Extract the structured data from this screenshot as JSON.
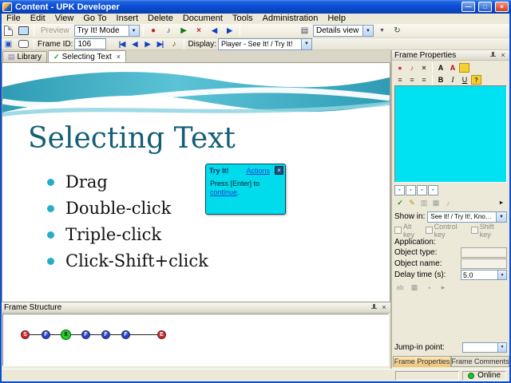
{
  "titlebar": {
    "title": "Content - UPK Developer"
  },
  "menubar": {
    "items": [
      "File",
      "Edit",
      "View",
      "Go To",
      "Insert",
      "Delete",
      "Document",
      "Tools",
      "Administration",
      "Help"
    ]
  },
  "toolbar1": {
    "preview": "Preview",
    "mode_value": "Try It! Mode",
    "view_value": "Details view"
  },
  "toolbar2": {
    "frame_id_label": "Frame ID:",
    "frame_id_value": "106",
    "display_label": "Display:",
    "display_value": "Player - See It! / Try It!"
  },
  "tabs": {
    "library_label": "Library",
    "active_label": "Selecting Text"
  },
  "slide": {
    "title": "Selecting Text",
    "bullets": [
      "Drag",
      "Double-click",
      "Triple-click",
      "Click-Shift+click"
    ]
  },
  "popup": {
    "title": "Try It!",
    "actions": "Actions",
    "line1": "Press [Enter] to",
    "link": "continue",
    "suffix": "."
  },
  "frame_structure": {
    "title": "Frame Structure",
    "nodes": [
      {
        "label": "S",
        "color": "#E02020",
        "text": "#ffffff"
      },
      {
        "label": "F",
        "color": "#2244DD",
        "text": "#ffffff"
      },
      {
        "label": "X",
        "color": "#22CC33",
        "text": "#000000"
      },
      {
        "label": "F",
        "color": "#2244DD",
        "text": "#ffffff"
      },
      {
        "label": "F",
        "color": "#2244DD",
        "text": "#ffffff"
      },
      {
        "label": "F",
        "color": "#2244DD",
        "text": "#ffffff"
      },
      {
        "label": "E",
        "color": "#E02020",
        "text": "#ffffff"
      }
    ]
  },
  "properties": {
    "title": "Frame Properties",
    "show_in_label": "Show in:",
    "show_in_value": "See It! / Try It!, Know It!...",
    "alt_key": "Alt key",
    "control_key": "Control key",
    "shift_key": "Shift key",
    "application_label": "Application:",
    "object_type_label": "Object type:",
    "object_name_label": "Object name:",
    "delay_label": "Delay time (s):",
    "delay_value": "5.0",
    "jump_in_label": "Jump-in point:",
    "tab_properties": "Frame Properties",
    "tab_comments": "Frame Comments"
  },
  "statusbar": {
    "online": "Online"
  },
  "colors": {
    "cyan_bubble": "#00DCEC",
    "cyan_editor": "#00E2F2",
    "bullet": "#25AEC6",
    "accent_teal": "#135F75"
  },
  "icons": {
    "dropdown": "▼",
    "close": "×",
    "minimize": "—",
    "maximize": "□",
    "check": "✓",
    "record": "●",
    "stop": "■",
    "play": "▶",
    "delete": "×",
    "sound": "♪",
    "first": "|◀",
    "prev": "◀",
    "next": "▶",
    "last": "▶|",
    "library": "▤",
    "layers": "▣",
    "details": "▤",
    "refresh": "↻",
    "align": "≡",
    "bold": "B",
    "italic": "I",
    "underline": "U",
    "font": "A",
    "font_color": "A",
    "help": "?",
    "pencil": "✎",
    "confirm": "✓",
    "duplicate": "▥",
    "grid": "▦",
    "clock": "◔",
    "advance": "▸",
    "expand": "►",
    "bullet_sq": "▪",
    "text_entry": "ab"
  }
}
